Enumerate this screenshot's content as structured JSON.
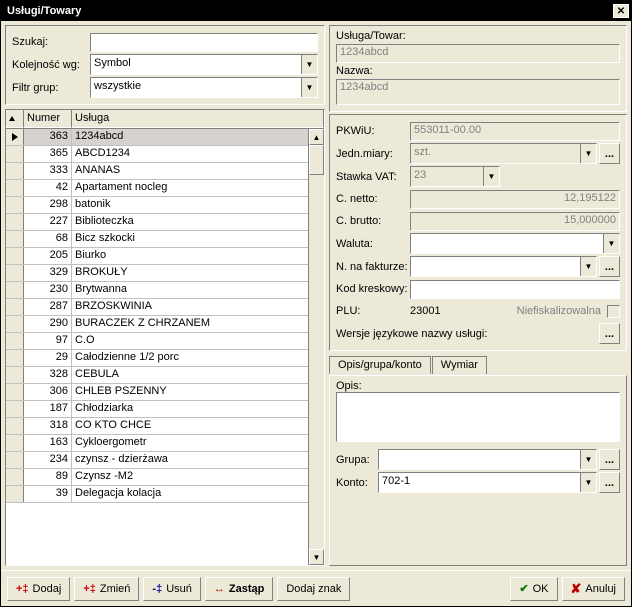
{
  "window": {
    "title": "Usługi/Towary"
  },
  "left": {
    "search_label": "Szukaj:",
    "search_value": "",
    "order_label": "Kolejność wg:",
    "order_value": "Symbol",
    "filter_label": "Filtr grup:",
    "filter_value": "wszystkie",
    "headers": {
      "numer": "Numer",
      "usluga": "Usługa"
    },
    "rows": [
      {
        "num": "363",
        "name": "1234abcd",
        "selected": true
      },
      {
        "num": "365",
        "name": "ABCD1234"
      },
      {
        "num": "333",
        "name": "ANANAS"
      },
      {
        "num": "42",
        "name": "Apartament nocleg"
      },
      {
        "num": "298",
        "name": "batonik"
      },
      {
        "num": "227",
        "name": "Biblioteczka"
      },
      {
        "num": "68",
        "name": "Bicz szkocki"
      },
      {
        "num": "205",
        "name": "Biurko"
      },
      {
        "num": "329",
        "name": "BROKUŁY"
      },
      {
        "num": "230",
        "name": "Brytwanna"
      },
      {
        "num": "287",
        "name": "BRZOSKWINIA"
      },
      {
        "num": "290",
        "name": "BURACZEK Z CHRZANEM"
      },
      {
        "num": "97",
        "name": "C.O"
      },
      {
        "num": "29",
        "name": "Całodzienne 1/2 porc"
      },
      {
        "num": "328",
        "name": "CEBULA"
      },
      {
        "num": "306",
        "name": "CHLEB PSZENNY"
      },
      {
        "num": "187",
        "name": "Chłodziarka"
      },
      {
        "num": "318",
        "name": "CO KTO CHCE"
      },
      {
        "num": "163",
        "name": "Cykloergometr"
      },
      {
        "num": "234",
        "name": "czynsz - dzierżawa"
      },
      {
        "num": "89",
        "name": "Czynsz -M2"
      },
      {
        "num": "39",
        "name": "Delegacja kolacja"
      }
    ]
  },
  "right": {
    "ut_label": "Usługa/Towar:",
    "ut_value": "1234abcd",
    "nazwa_label": "Nazwa:",
    "nazwa_value": "1234abcd",
    "pkwiu_label": "PKWiU:",
    "pkwiu_value": "553011-00.00",
    "jedn_label": "Jedn.miary:",
    "jedn_value": "szt.",
    "vat_label": "Stawka VAT:",
    "vat_value": "23",
    "cnetto_label": "C. netto:",
    "cnetto_value": "12,195122",
    "cbrutto_label": "C. brutto:",
    "cbrutto_value": "15,000000",
    "waluta_label": "Waluta:",
    "waluta_value": "",
    "nfakt_label": "N. na fakturze:",
    "nfakt_value": "",
    "kod_label": "Kod kreskowy:",
    "kod_value": "",
    "plu_label": "PLU:",
    "plu_value": "23001",
    "nief_label": "Niefiskalizowalna",
    "wersje_label": "Wersje językowe nazwy usługi:",
    "tabs": {
      "t1": "Opis/grupa/konto",
      "t2": "Wymiar"
    },
    "opis_label": "Opis:",
    "grupa_label": "Grupa:",
    "grupa_value": "",
    "konto_label": "Konto:",
    "konto_value": "702-1"
  },
  "buttons": {
    "dodaj": "Dodaj",
    "zmien": "Zmień",
    "usun": "Usuń",
    "zastap": "Zastąp",
    "dodajznak": "Dodaj znak",
    "ok": "OK",
    "anuluj": "Anuluj",
    "dots": "..."
  }
}
